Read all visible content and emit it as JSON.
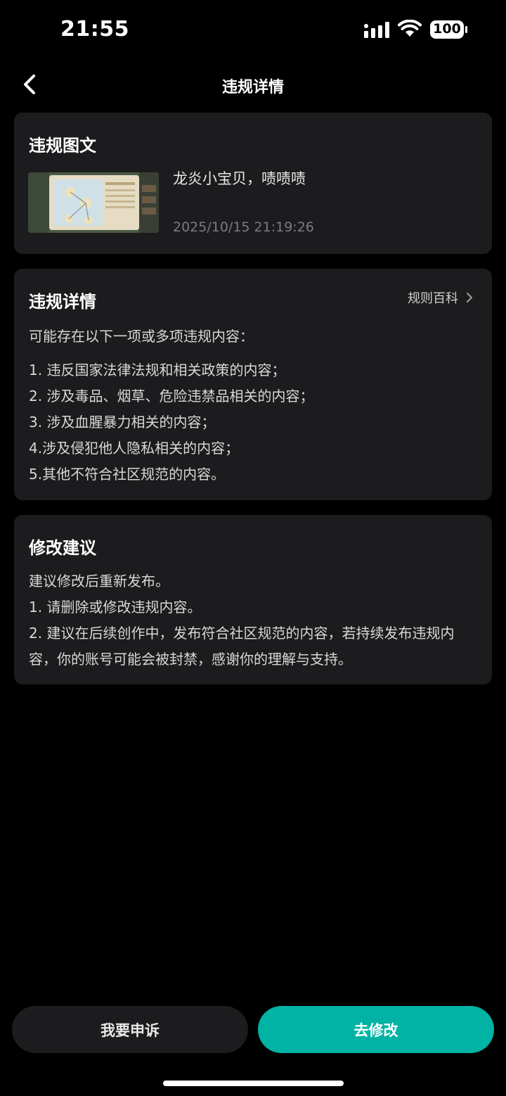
{
  "status_bar": {
    "time": "21:55",
    "battery": "100"
  },
  "nav": {
    "title": "违规详情"
  },
  "post_card": {
    "title": "违规图文",
    "text": "龙炎小宝贝，啧啧啧",
    "time": "2025/10/15 21:19:26"
  },
  "detail_card": {
    "title": "违规详情",
    "rules_link": "规则百科",
    "intro": "可能存在以下一项或多项违规内容：",
    "items": [
      "1. 违反国家法律法规和相关政策的内容；",
      "2. 涉及毒品、烟草、危险违禁品相关的内容；",
      "3. 涉及血腥暴力相关的内容；",
      "4.涉及侵犯他人隐私相关的内容；",
      "5.其他不符合社区规范的内容。"
    ]
  },
  "advice_card": {
    "title": "修改建议",
    "lines": [
      "建议修改后重新发布。",
      "1. 请删除或修改违规内容。",
      "2. 建议在后续创作中，发布符合社区规范的内容，若持续发布违规内容，你的账号可能会被封禁，感谢你的理解与支持。"
    ]
  },
  "buttons": {
    "appeal": "我要申诉",
    "edit": "去修改"
  },
  "colors": {
    "background": "#000000",
    "card": "#1c1c1e",
    "accent": "#00b3a4",
    "muted_text": "#7c7c80"
  },
  "icons": {
    "back": "chevron-left-icon",
    "rules": "chevron-right-icon",
    "signal": "cellular-signal-icon",
    "wifi": "wifi-icon",
    "battery": "battery-icon"
  }
}
